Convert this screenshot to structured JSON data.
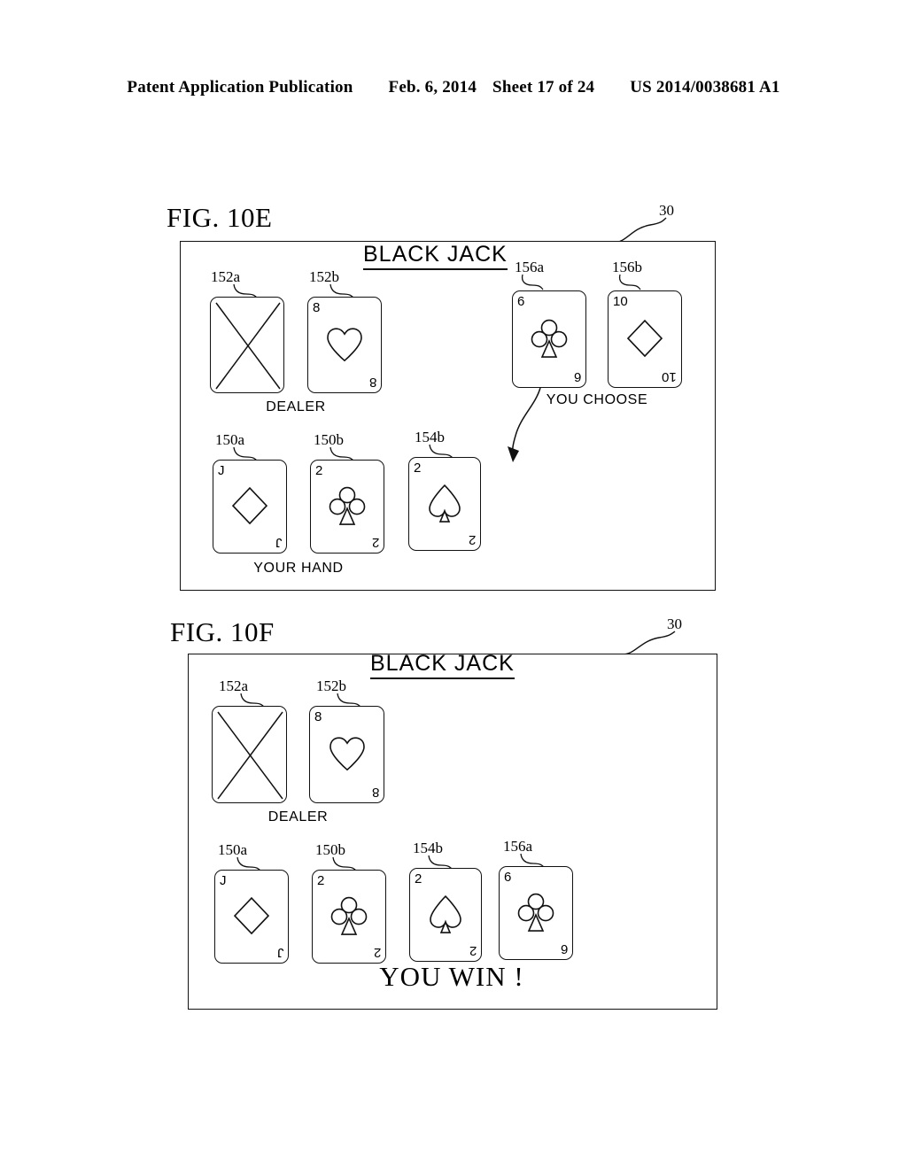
{
  "header": {
    "publication": "Patent Application Publication",
    "date": "Feb. 6, 2014",
    "sheet": "Sheet 17 of 24",
    "patent_number": "US 2014/0038681 A1"
  },
  "figures": [
    {
      "label": "FIG. 10E",
      "screen_ref": "30",
      "title": "BLACK JACK",
      "dealer_caption": "DEALER",
      "hand_caption": "YOUR HAND",
      "choose_caption": "YOU CHOOSE",
      "dealer_cards": [
        {
          "ref": "152a",
          "rank": "",
          "suit": "facedown",
          "facedown": true
        },
        {
          "ref": "152b",
          "rank": "8",
          "suit": "heart",
          "facedown": false
        }
      ],
      "choose_cards": [
        {
          "ref": "156a",
          "rank": "6",
          "suit": "club",
          "facedown": false
        },
        {
          "ref": "156b",
          "rank": "10",
          "suit": "diamond",
          "facedown": false
        }
      ],
      "hand_cards": [
        {
          "ref": "150a",
          "rank": "J",
          "suit": "diamond",
          "facedown": false
        },
        {
          "ref": "150b",
          "rank": "2",
          "suit": "club",
          "facedown": false
        },
        {
          "ref": "154b",
          "rank": "2",
          "suit": "spade",
          "facedown": false
        }
      ]
    },
    {
      "label": "FIG. 10F",
      "screen_ref": "30",
      "title": "BLACK JACK",
      "dealer_caption": "DEALER",
      "result_message": "YOU WIN !",
      "dealer_cards": [
        {
          "ref": "152a",
          "rank": "",
          "suit": "facedown",
          "facedown": true
        },
        {
          "ref": "152b",
          "rank": "8",
          "suit": "heart",
          "facedown": false
        }
      ],
      "hand_cards": [
        {
          "ref": "150a",
          "rank": "J",
          "suit": "diamond",
          "facedown": false
        },
        {
          "ref": "150b",
          "rank": "2",
          "suit": "club",
          "facedown": false
        },
        {
          "ref": "154b",
          "rank": "2",
          "suit": "spade",
          "facedown": false
        },
        {
          "ref": "156a",
          "rank": "6",
          "suit": "club",
          "facedown": false
        }
      ]
    }
  ],
  "colors": {
    "ink": "#111111",
    "paper": "#ffffff"
  }
}
